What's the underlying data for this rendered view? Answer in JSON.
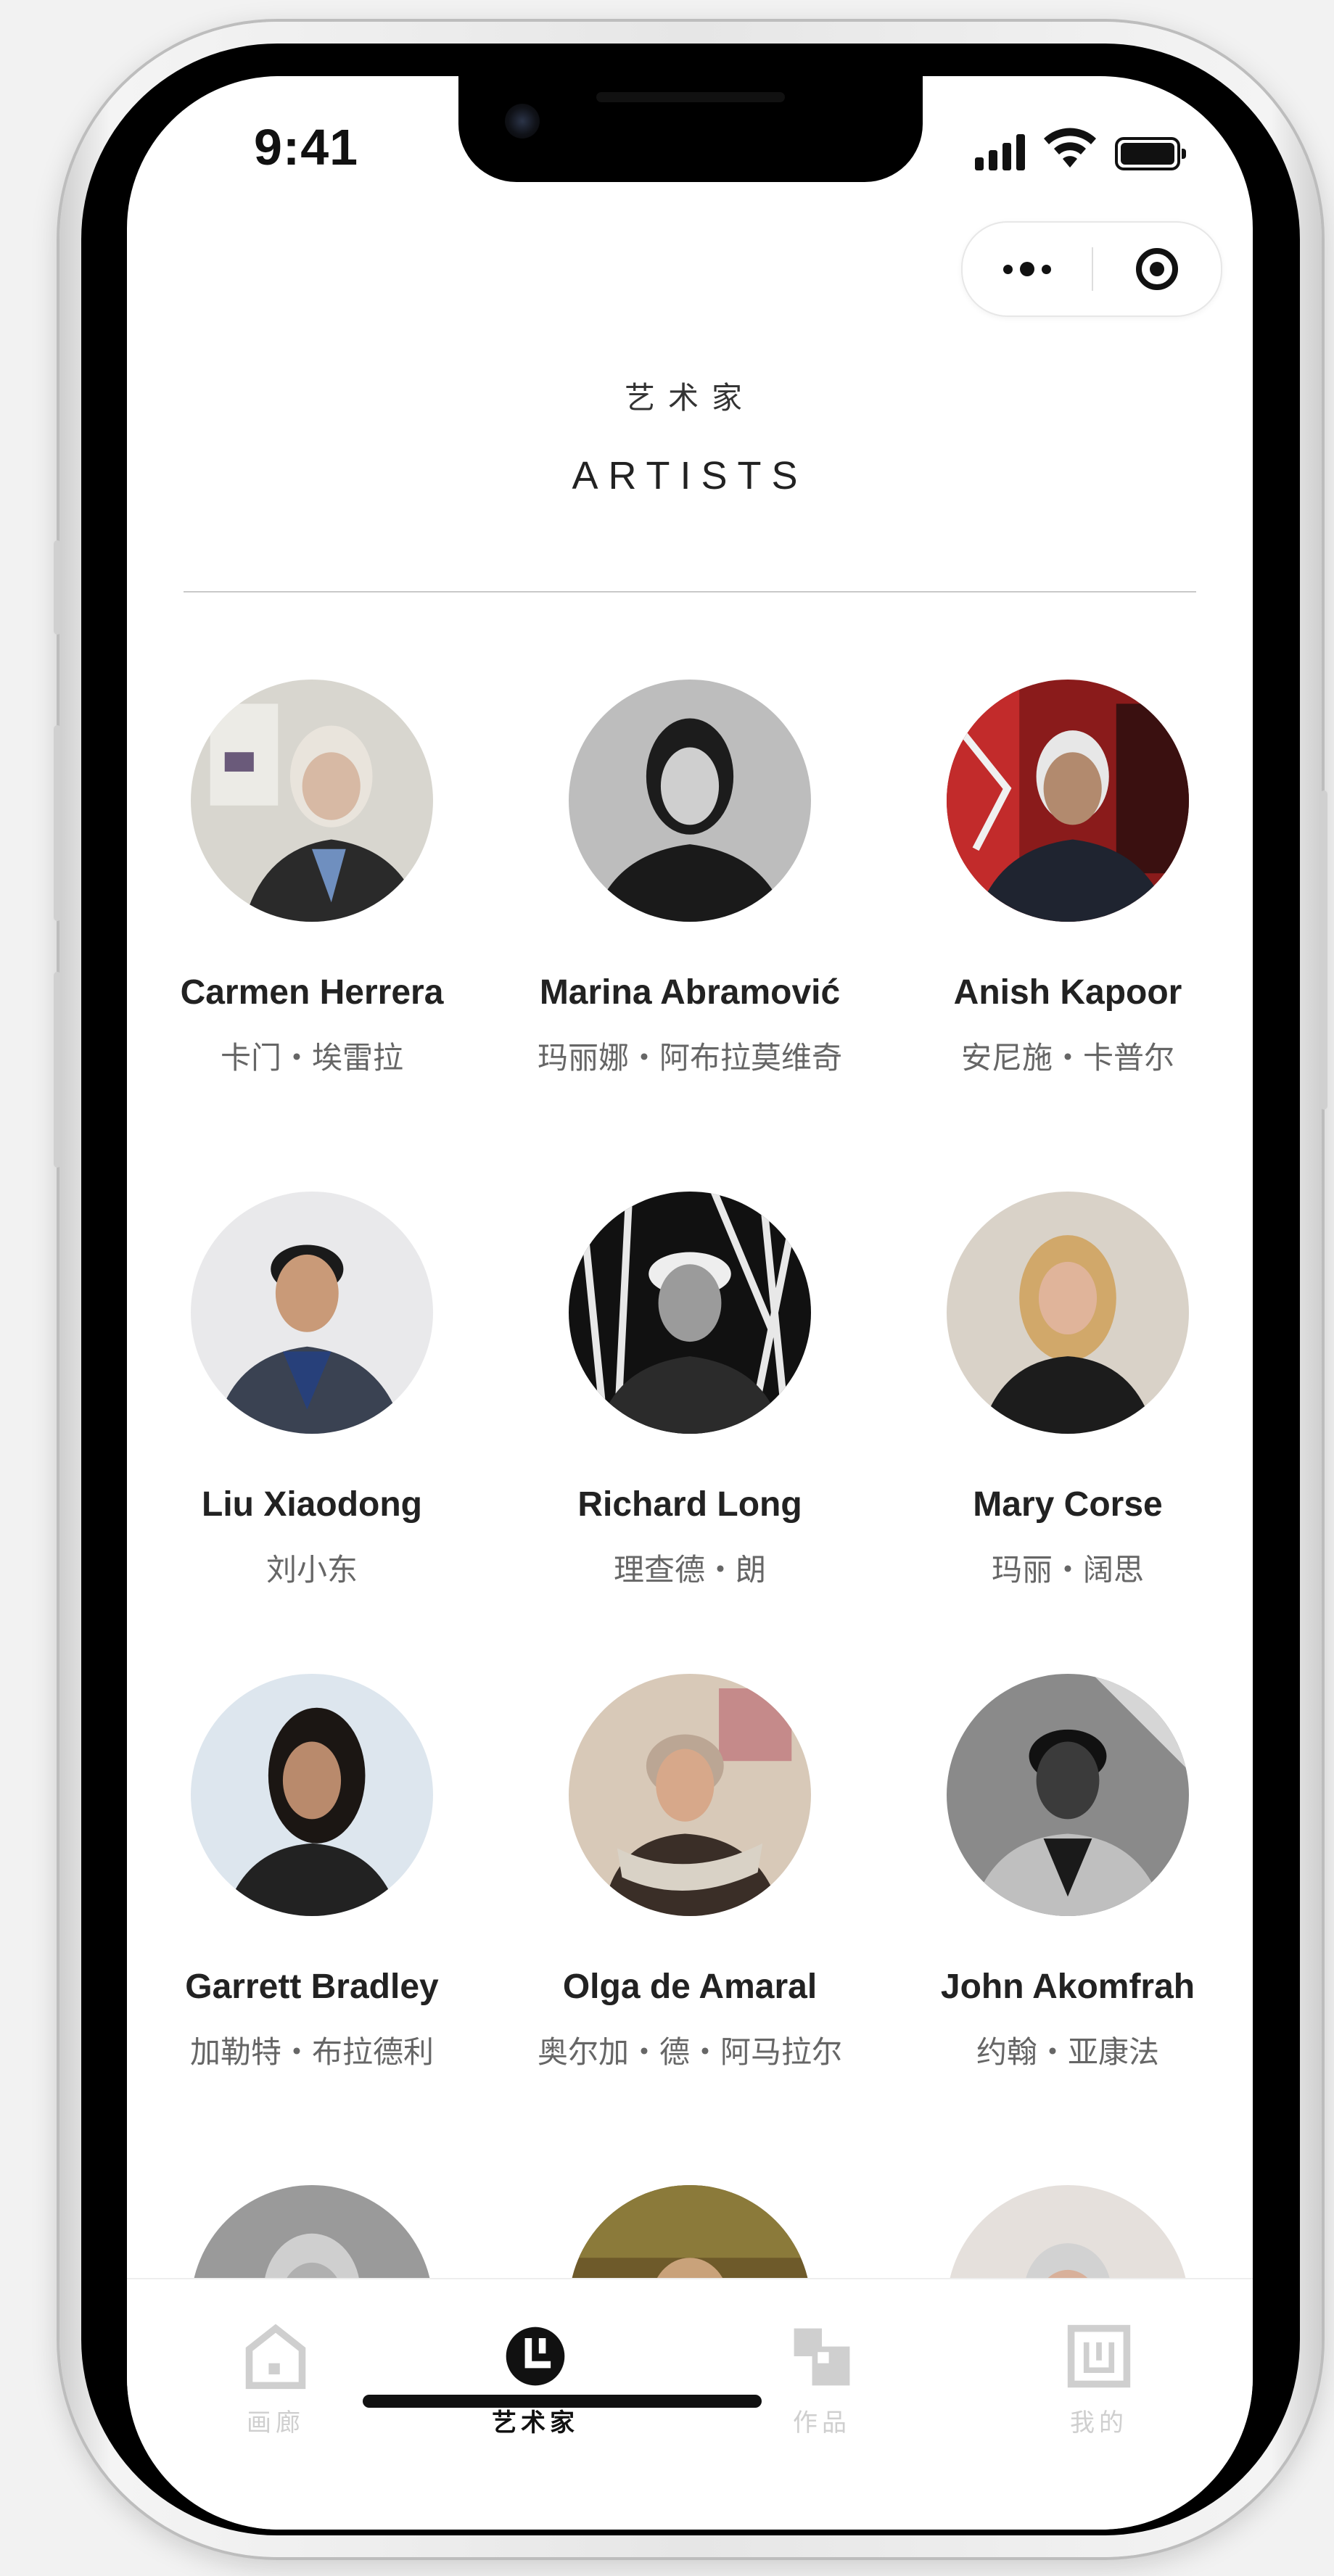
{
  "status_bar": {
    "time": "9:41"
  },
  "header": {
    "title_cn": "艺术家",
    "title_en": "ARTISTS"
  },
  "artists": [
    {
      "name_en": "Carmen Herrera",
      "name_cn": "卡门・埃雷拉"
    },
    {
      "name_en": "Marina Abramović",
      "name_cn": "玛丽娜・阿布拉莫维奇"
    },
    {
      "name_en": "Anish Kapoor",
      "name_cn": "安尼施・卡普尔"
    },
    {
      "name_en": "Liu Xiaodong",
      "name_cn": "刘小东"
    },
    {
      "name_en": "Richard Long",
      "name_cn": "理查德・朗"
    },
    {
      "name_en": "Mary Corse",
      "name_cn": "玛丽・阔思"
    },
    {
      "name_en": "Garrett Bradley",
      "name_cn": "加勒特・布拉德利"
    },
    {
      "name_en": "Olga de Amaral",
      "name_cn": "奥尔加・德・阿马拉尔"
    },
    {
      "name_en": "John Akomfrah",
      "name_cn": "约翰・亚康法"
    }
  ],
  "tabbar": {
    "tabs": [
      {
        "label": "画廊",
        "icon": "gallery-house-icon",
        "active": false
      },
      {
        "label": "艺术家",
        "icon": "artist-clock-icon",
        "active": true
      },
      {
        "label": "作品",
        "icon": "artworks-icon",
        "active": false
      },
      {
        "label": "我的",
        "icon": "profile-icon",
        "active": false
      }
    ]
  },
  "colors": {
    "active": "#111111",
    "inactive": "#cfcfcf",
    "divider": "#c9c9c9"
  }
}
